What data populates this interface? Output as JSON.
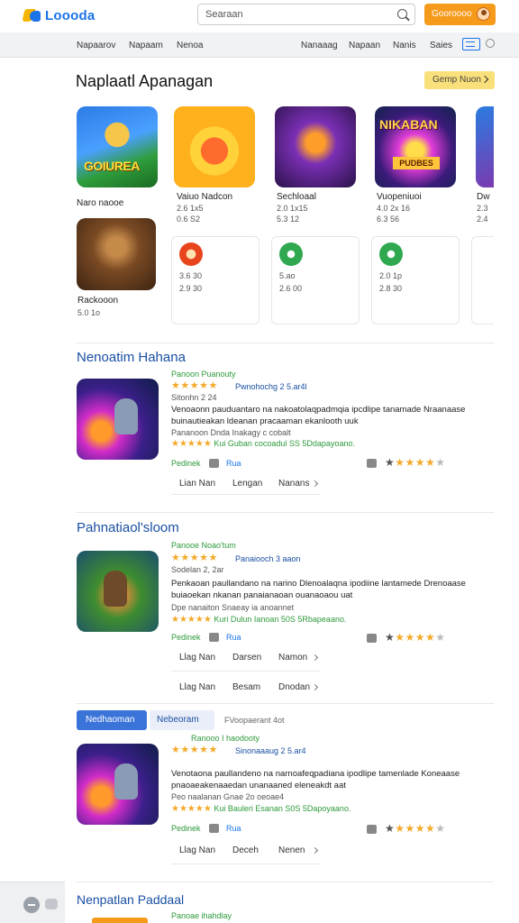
{
  "header": {
    "logo_text": "Loooda",
    "search_placeholder": "Searaan",
    "signin_label": "Gooroooo"
  },
  "nav": {
    "items": [
      "Napaarov",
      "Napaam",
      "Nenoa",
      "Nanaaag",
      "Napaan",
      "Nanis",
      "Saies"
    ]
  },
  "featured": {
    "title": "Naplaatl Apanagan",
    "see_all": "Gemp Nuon",
    "tile1_text": "GOIUREA",
    "tile4_text1": "NIKABAN",
    "tile4_text2": "PUDBES",
    "games": [
      {
        "name": "Naro naooe",
        "l1": "",
        "l2": ""
      },
      {
        "name": "Vaiuo Nadcon",
        "l1": "2.6 1x5",
        "l2": "0.6 S2"
      },
      {
        "name": "Sechloaal",
        "l1": "2.0 1x15",
        "l2": "5.3 12"
      },
      {
        "name": "Vuopeniuoi",
        "l1": "4.0 2x 16",
        "l2": "6.3 56"
      },
      {
        "name": "Dw",
        "l1": "2.3",
        "l2": "2.4"
      }
    ],
    "second_row": {
      "name": "Rackooon",
      "sub": "5.0 1o",
      "cards": [
        {
          "l1": "3.6 30",
          "l2": "2.9 30"
        },
        {
          "l1": "5.ao",
          "l2": "2.6 00"
        },
        {
          "l1": "2.0 1p",
          "l2": "2.8 30"
        }
      ]
    }
  },
  "reviews": [
    {
      "title": "Nenoatim Hahana",
      "category": "Panoon Puanouty",
      "stars": "★★★★★",
      "meta": "Pwnohochg 2 5.ar4l",
      "date": "Sitonhn 2 24",
      "desc": "Venoaonn pauduantaro na nakoatolaqpadmqia ipcdlipe tanamade Nraanaase buinautieakan ldeanan pracaaman ekanlooth uuk",
      "note": "Pananoon Dnda Inakagy c cobalt",
      "mini_stars": "★★★★★",
      "mini_text": "Kui Guban cocoadul SS 5Ddapayoano.",
      "act1": "Pedinek",
      "act2": "Rua",
      "rating_on": "★★★★",
      "rating_off": "★",
      "links": [
        "Lian Nan",
        "Lengan",
        "Nanans"
      ]
    },
    {
      "title": "Pahnatiaol'sloom",
      "category": "Panooe Noao'tum",
      "stars": "★★★★★",
      "meta": "Panaiooch 3 aaon",
      "date": "Sodelan 2, 2ar",
      "desc": "Penkaoan paullandano na narino Dlenoalaqna ipodiine lantamede Drenoaase buiaoekan nkanan panaianaoan ouanaoaou uat",
      "note": "Dpe nanaiton Snaeay ia anoannet",
      "mini_stars": "★★★★★",
      "mini_text": "Kuri Dulun Ianoan 50S 5Rbapeaano.",
      "act1": "Pedinek",
      "act2": "Rua",
      "rating_on": "★★★★",
      "rating_off": "★",
      "links": [
        "Llag Nan",
        "Darsen",
        "Namon"
      ],
      "links2": [
        "Llag Nan",
        "Besam",
        "Dnodan"
      ]
    },
    {
      "title": "",
      "category": "Ranooo I haodooty",
      "stars": "★★★★★",
      "meta": "Sinonaaaug 2 5.ar4",
      "date": "",
      "desc": "Venotaona paullandeno na narnoafeqpadiana ipodlipe tamenlade Koneaase pnaoaeakenaaedan unanaaned eleneakdt aat",
      "note": "Peo naalanan Gnae 2o oeoae4",
      "mini_stars": "★★★★★",
      "mini_text": "Kui Bauleri Esanan S0S 5Dapoyaano.",
      "act1": "Pedinek",
      "act2": "Rua",
      "rating_on": "★★★★",
      "rating_off": "★",
      "links": [
        "Llag Nan",
        "Deceh",
        "Nenen"
      ]
    }
  ],
  "tabs": {
    "active": "Nedhaoman",
    "second": "Nebeoram",
    "note": "FVoopaerant 4ot"
  },
  "bottom": {
    "title": "Nenpatlan Paddaal",
    "sub": "Panoae ihahdlay"
  }
}
